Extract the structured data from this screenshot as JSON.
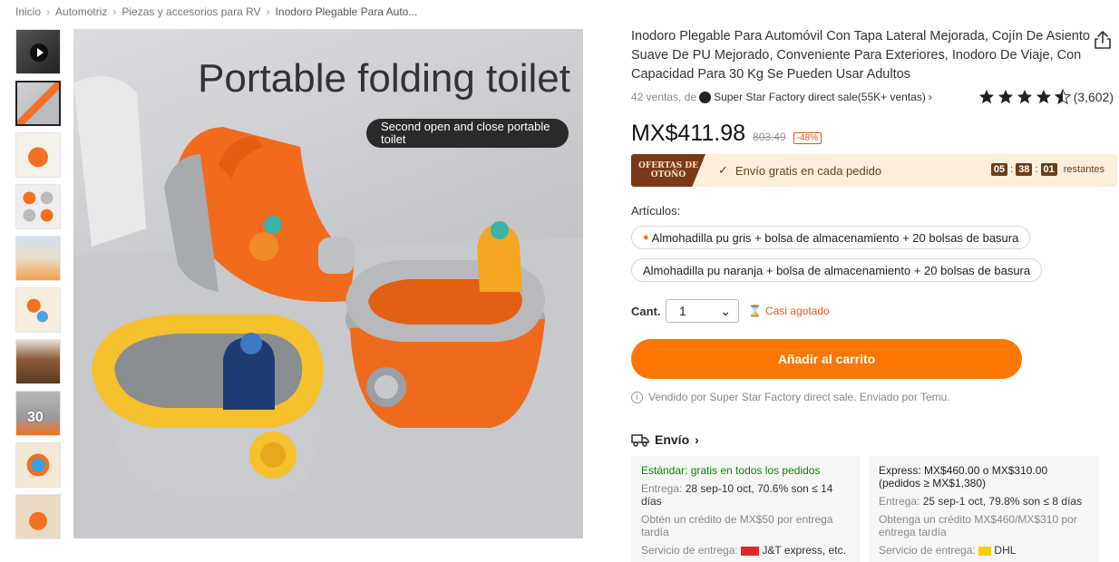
{
  "breadcrumb": [
    "Inicio",
    "Automotriz",
    "Piezas y accesorios para RV",
    "Inodoro Plegable Para Auto..."
  ],
  "gallery": {
    "thumb_count": 10,
    "thumb_30_label": "30",
    "main_image": {
      "headline": "Portable folding toilet",
      "pill": "Second open and close portable toilet"
    }
  },
  "product": {
    "title": "Inodoro Plegable Para Automóvil Con Tapa Lateral Mejorada, Cojín De Asiento Suave De PU Mejorado, Conveniente Para Exteriores, Inodoro De Viaje, Con Capacidad Para 30 Kg Se Pueden Usar Adultos",
    "sales": "42 ventas, de",
    "store": "Super Star Factory direct sale(55K+ ventas)",
    "rating_stars": 4.5,
    "rating_count": "(3,602)",
    "price": "MX$411.98",
    "old_price": "803.49",
    "discount": "-48%"
  },
  "promo": {
    "badge": "OFERTAS DE OTOÑO",
    "shipping": "Envío gratis en cada pedido",
    "timer": {
      "h": "05",
      "m": "38",
      "s": "01",
      "suffix": "restantes"
    }
  },
  "articles": {
    "label": "Artículos:",
    "options": [
      "Almohadilla pu gris + bolsa de almacenamiento + 20 bolsas de basura",
      "Almohadilla pu naranja + bolsa de almacenamiento + 20 bolsas de basura"
    ]
  },
  "quantity": {
    "label": "Cant.",
    "value": "1",
    "stock": "Casi agotado"
  },
  "cart_button": "Añadir al carrito",
  "seller_note": "Vendido por Super Star Factory direct sale. Enviado por Temu.",
  "shipping": {
    "title": "Envío",
    "standard": {
      "head": "Estándar: gratis en todos los pedidos",
      "delivery_label": "Entrega:",
      "delivery_value": "28 sep-10 oct, 70.6% son ≤ 14 días",
      "credit": "Obtén un crédito de MX$50 por entrega tardía",
      "service_label": "Servicio de entrega:",
      "service_value": "J&T express, etc."
    },
    "express": {
      "head": "Express: MX$460.00 o MX$310.00 (pedidos ≥ MX$1,380)",
      "delivery_label": "Entrega:",
      "delivery_value": "25 sep-1 oct, 79.8% son ≤ 8 días",
      "credit": "Obtenga un crédito MX$460/MX$310 por entrega tardía",
      "service_label": "Servicio de entrega:",
      "service_value": "DHL"
    }
  },
  "colors": {
    "accent": "#fb7701",
    "promo_bg": "#fbeedc",
    "success": "#0a8800"
  }
}
